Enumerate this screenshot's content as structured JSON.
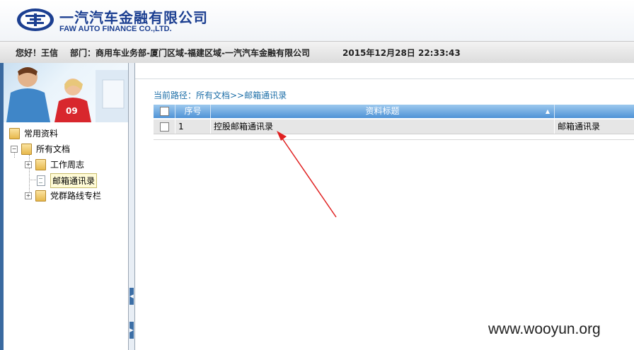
{
  "header": {
    "company_cn": "一汽汽车金融有限公司",
    "company_en": "FAW AUTO FINANCE CO.,LTD."
  },
  "infobar": {
    "greeting": "您好！王信",
    "department": "部门：商用车业务部-厦门区域-福建区域-一汽汽车金融有限公司",
    "datetime": "2015年12月28日  22:33:43"
  },
  "tree": {
    "items": [
      {
        "label": "常用资料",
        "icon": "folder-icon"
      },
      {
        "label": "所有文档",
        "icon": "folder-icon",
        "expander": "−"
      },
      {
        "label": "工作周志",
        "icon": "folder-icon",
        "expander": "+"
      },
      {
        "label": "邮箱通讯录",
        "icon": "document-icon",
        "selected": true
      },
      {
        "label": "党群路线专栏",
        "icon": "folder-icon",
        "expander": "+"
      }
    ]
  },
  "content": {
    "breadcrumb": "当前路径：所有文档>>邮箱通讯录",
    "columns": [
      "序号",
      "资料标题"
    ],
    "rows": [
      {
        "index": "1",
        "title": "控股邮箱通讯录",
        "category": "邮箱通讯录"
      }
    ]
  },
  "watermark": "www.wooyun.org",
  "colors": {
    "brand_blue": "#1c3f91",
    "grid_header": "#4f93d6",
    "link_blue": "#1e6fa8",
    "annotation_red": "#e02020"
  }
}
